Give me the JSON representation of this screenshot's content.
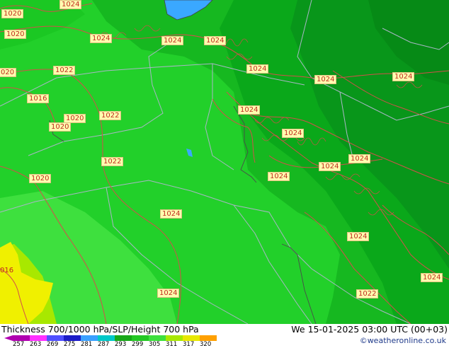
{
  "map": {
    "isobar_labels": [
      "1020",
      "1024",
      "1020",
      "1024",
      "1024",
      "1024",
      "020",
      "1022",
      "1024",
      "1024",
      "1024",
      "1016",
      "1020",
      "1022",
      "1020",
      "1024",
      "1024",
      "1022",
      "1024",
      "1024",
      "1024",
      "1020",
      "1024",
      "1024",
      "1024",
      "016",
      "1024",
      "1022",
      "1024"
    ],
    "colors": {
      "thickness_bright": "#22d02a",
      "thickness_mid": "#16b820",
      "thickness_dark": "#08961a",
      "thickness_yellow": "#f0f000",
      "isobar_line": "#d2504a",
      "border_line": "#a9b6c6",
      "coast_line": "#4a4a4a"
    }
  },
  "footer": {
    "title": "Thickness 700/1000 hPa/SLP/Height 700 hPa",
    "time": "We 15-01-2025 03:00 UTC (00+03)",
    "credit": "©weatheronline.co.uk",
    "scale_ticks": [
      "257",
      "263",
      "269",
      "275",
      "281",
      "287",
      "293",
      "299",
      "305",
      "311",
      "317",
      "320"
    ],
    "scale_colors": [
      "#b000b0",
      "#ff30ff",
      "#5050ff",
      "#1c1cc8",
      "#3aa0ff",
      "#00c8c8",
      "#18a818",
      "#23c823",
      "#3ee03e",
      "#a8e800",
      "#e8e800",
      "#ffa000"
    ]
  }
}
